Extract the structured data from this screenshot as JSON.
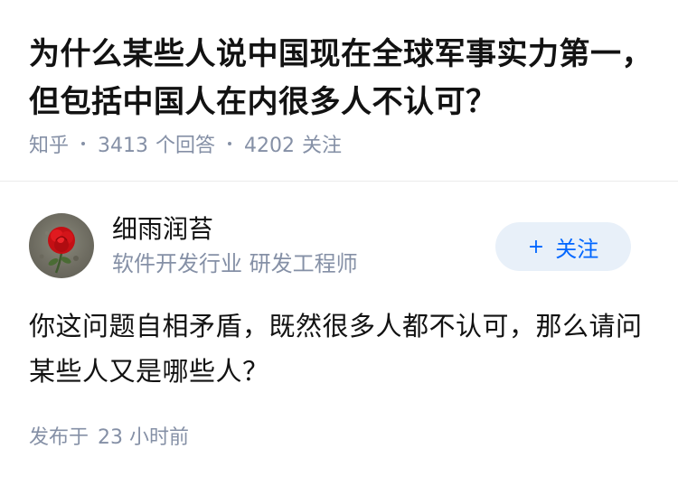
{
  "question": {
    "title": "为什么某些人说中国现在全球军事实力第一，但包括中国人在内很多人不认可？",
    "source": "知乎",
    "answer_count": "3413",
    "answer_label": "个回答",
    "follower_count": "4202",
    "follower_label": "关注"
  },
  "answer": {
    "author": {
      "name": "细雨润苔",
      "headline": "软件开发行业 研发工程师",
      "avatar_icon": "red-rose-avatar"
    },
    "follow_button": {
      "icon": "plus-icon",
      "label": "关注",
      "plus": "+"
    },
    "content": "你这问题自相矛盾，既然很多人都不认可，那么请问某些人又是哪些人？",
    "published_label": "发布于",
    "published_time": "23 小时前"
  },
  "colors": {
    "text_primary": "#121212",
    "text_secondary": "#8590a6",
    "accent": "#0066ff",
    "follow_bg": "#e8f0f9",
    "divider": "#ebebeb"
  }
}
